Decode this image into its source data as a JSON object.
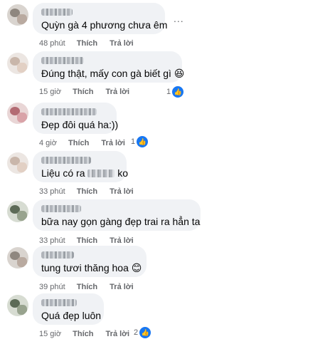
{
  "comments": [
    {
      "text": "Quỳn gà 4 phương chưa êm",
      "time": "48 phút",
      "like": "Thích",
      "reply": "Trả lời",
      "reactions": ""
    },
    {
      "text_before": "Đúng thật, mấy con gà biết gì",
      "emoji": "😆",
      "time": "15 giờ",
      "like": "Thích",
      "reply": "Trả lời",
      "reactions": "1"
    },
    {
      "text": "Đẹp đôi quá ha:))",
      "time": "4 giờ",
      "like": "Thích",
      "reply": "Trả lời",
      "reactions": "1"
    },
    {
      "text_before": "Liệu có ra",
      "text_after": "ko",
      "time": "33 phút",
      "like": "Thích",
      "reply": "Trả lời",
      "reactions": ""
    },
    {
      "text": "bữa nay gọn gàng đẹp trai ra hẳn ta",
      "time": "33 phút",
      "like": "Thích",
      "reply": "Trả lời",
      "reactions": ""
    },
    {
      "text_before": "tung tươi thăng hoa",
      "emoji": "😊",
      "time": "39 phút",
      "like": "Thích",
      "reply": "Trả lời",
      "reactions": ""
    },
    {
      "text": "Quá đẹp luôn",
      "time": "15 giờ",
      "like": "Thích",
      "reply": "Trả lời",
      "reactions": "2"
    }
  ],
  "more_options": "...",
  "like_icon": "thumbs-up-icon"
}
